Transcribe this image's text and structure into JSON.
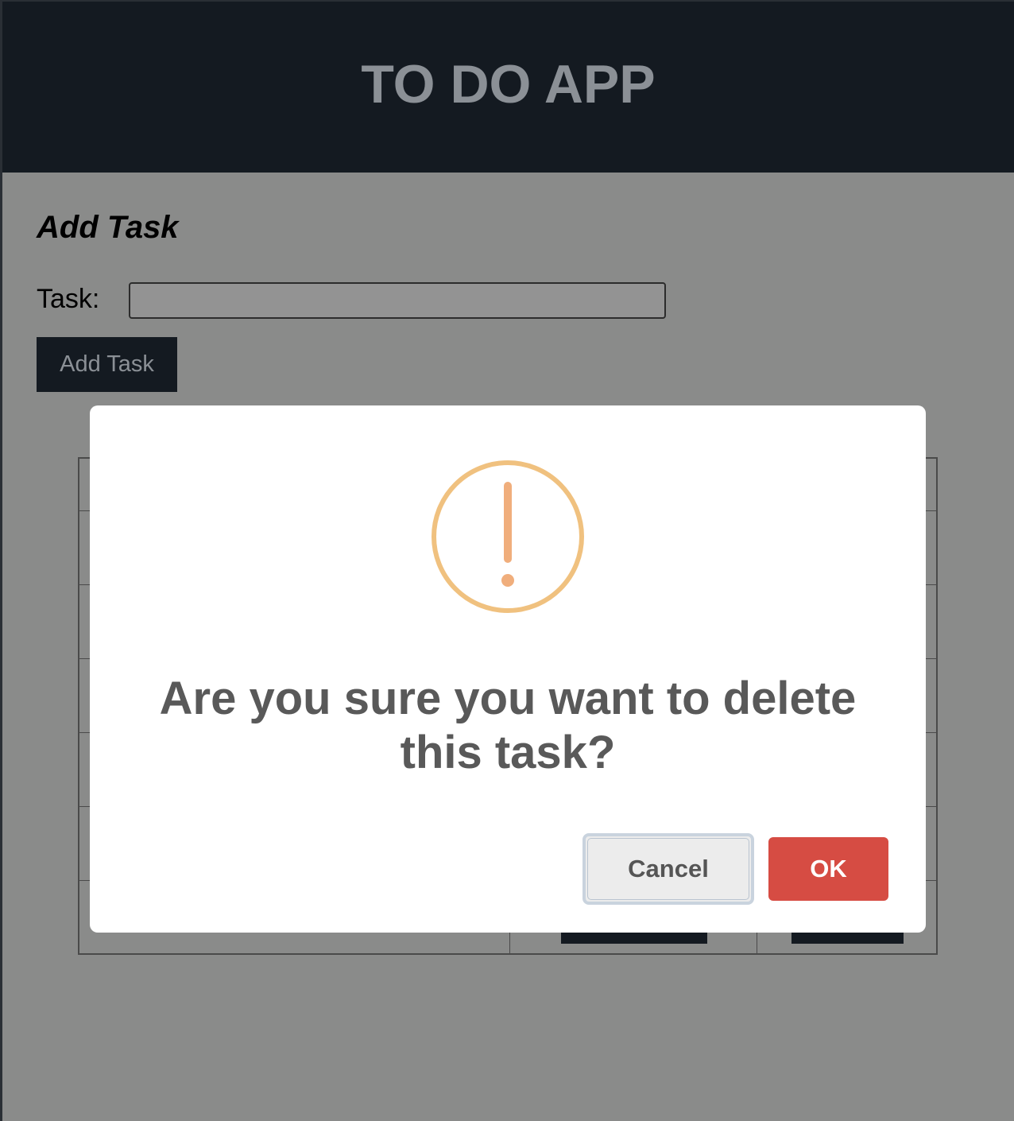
{
  "header": {
    "title": "TO DO APP"
  },
  "add_form": {
    "heading": "Add Task",
    "task_label": "Task:",
    "task_value": "",
    "add_button_label": "Add Task"
  },
  "dialog": {
    "icon": "warning-exclamation-icon",
    "message": "Are you sure you want to delete this task?",
    "cancel_label": "Cancel",
    "ok_label": "OK"
  },
  "colors": {
    "header_bg": "#141a21",
    "overlay_bg": "#8a8b8a",
    "warning_ring": "#f0c17f",
    "warning_mark": "#f0ae7c",
    "ok_button": "#d64c43"
  }
}
